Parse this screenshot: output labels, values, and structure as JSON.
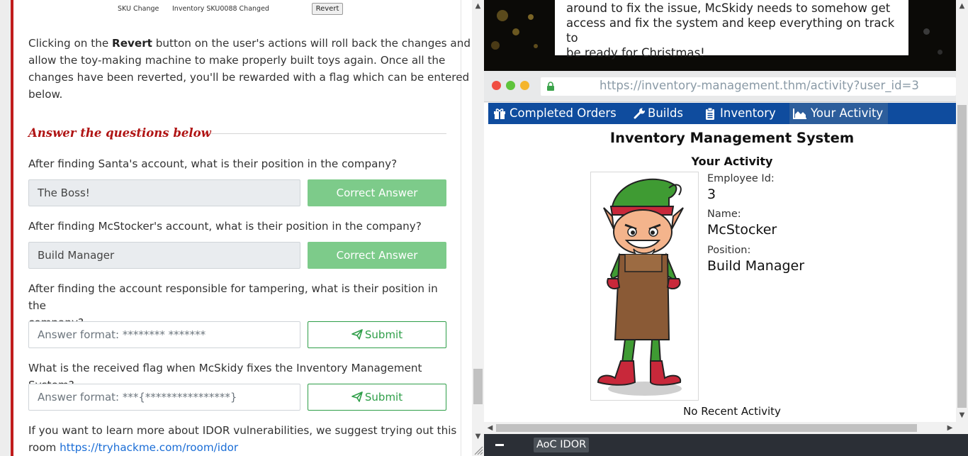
{
  "left": {
    "table_snip": {
      "col1": "SKU Change",
      "col2": "Inventory SKU0088 Changed",
      "revert_label": "Revert"
    },
    "intro": {
      "pre": "Clicking on the ",
      "bold": "Revert",
      "line1_rest": " button on the user's actions will roll back the changes and",
      "line2": "allow the toy-making machine to make properly built toys again. Once all the",
      "line3": "changes have been reverted, you'll be rewarded with a flag which can be entered",
      "line4": "below."
    },
    "answer_heading": "Answer the questions below",
    "questions": [
      {
        "text": "After finding Santa's account, what is their position in the company?",
        "answer": "The Boss!",
        "button": "Correct Answer"
      },
      {
        "text": "After finding McStocker's account, what is their position in the company?",
        "answer": "Build Manager",
        "button": "Correct Answer"
      },
      {
        "text_line1": "After finding the account responsible for tampering, what is their position in the",
        "text_line2": "company?",
        "placeholder": "Answer format: ******** *******",
        "button": "Submit"
      },
      {
        "text": "What is the received flag when McSkidy fixes the Inventory Management System?",
        "placeholder": "Answer format: ***{****************}",
        "button": "Submit"
      }
    ],
    "outro": {
      "line1": "If you want to learn more about IDOR vulnerabilities, we suggest trying out this",
      "line2_pre": "room ",
      "link": "https://tryhackme.com/room/idor"
    }
  },
  "right": {
    "note": {
      "line1": "around to fix the issue, McSkidy needs to somehow get",
      "line2": "access and fix the system and keep everything on track to",
      "line3": "be ready for Christmas!"
    },
    "browser": {
      "url": "https://inventory-management.thm/activity?user_id=3"
    },
    "nav": {
      "items": [
        {
          "label": "Completed Orders",
          "icon": "gift-icon"
        },
        {
          "label": "Builds",
          "icon": "wrench-icon"
        },
        {
          "label": "Inventory",
          "icon": "clipboard-icon"
        },
        {
          "label": "Your Activity",
          "icon": "chart-area-icon"
        }
      ]
    },
    "page_title": "Inventory Management System",
    "section_title": "Your Activity",
    "profile": {
      "employee_id_label": "Employee Id:",
      "employee_id": "3",
      "name_label": "Name:",
      "name": "McStocker",
      "position_label": "Position:",
      "position": "Build Manager"
    },
    "no_recent": "No Recent Activity",
    "taskbar": {
      "label": "AoC IDOR"
    }
  },
  "colors": {
    "accent_red": "#c01c1c",
    "correct_green": "#7dcb8a",
    "submit_green": "#2e9e48",
    "nav_blue": "#0f4c9e",
    "link_blue": "#1a6dd6"
  }
}
